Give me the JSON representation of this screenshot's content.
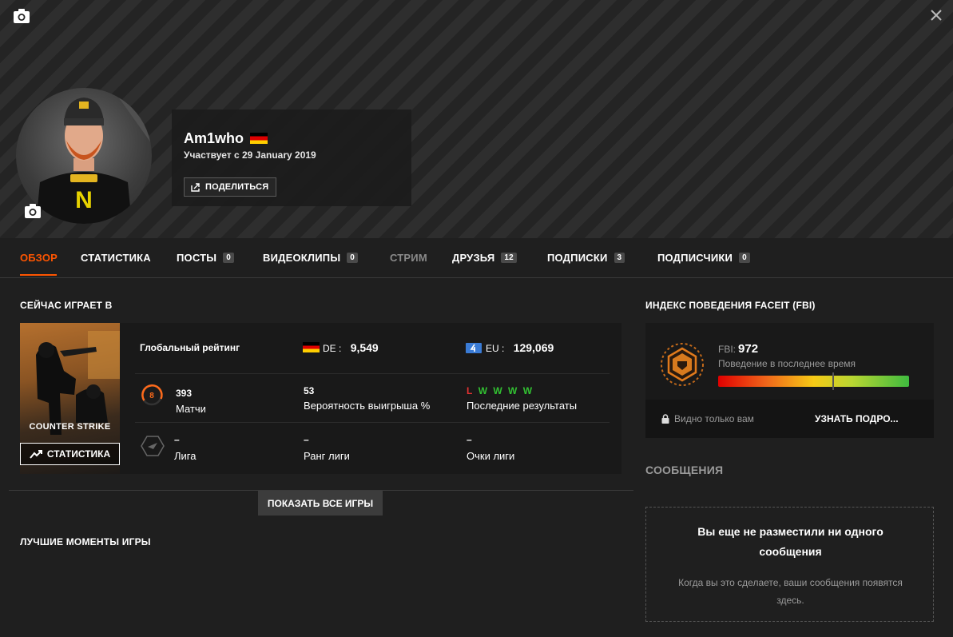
{
  "header": {
    "nickname": "Am1who",
    "joined": "Участвует с 29 January 2019",
    "share_label": "ПОДЕЛИТЬСЯ"
  },
  "tabs": [
    {
      "label": "ОБЗОР",
      "count": null
    },
    {
      "label": "СТАТИСТИКА",
      "count": null
    },
    {
      "label": "ПОСТЫ",
      "count": "0"
    },
    {
      "label": "ВИДЕОКЛИПЫ",
      "count": "0"
    },
    {
      "label": "СТРИМ",
      "count": null
    },
    {
      "label": "ДРУЗЬЯ",
      "count": "12"
    },
    {
      "label": "ПОДПИСКИ",
      "count": "3"
    },
    {
      "label": "ПОДПИСЧИКИ",
      "count": "0"
    }
  ],
  "now_playing": {
    "title": "СЕЙЧАС ИГРАЕТ В",
    "game_logo": "COUNTER STRIKE",
    "stats_button": "СТАТИСТИКА",
    "global_rating_label": "Глобальный рейтинг",
    "country_label": "DE :",
    "country_rank": "9,549",
    "region_label": "EU :",
    "region_rank": "129,069",
    "skill_level": "8",
    "matches_value": "393",
    "matches_label": "Матчи",
    "winrate_value": "53",
    "winrate_label": "Вероятность выигрыша %",
    "recent_results": [
      "L",
      "W",
      "W",
      "W",
      "W"
    ],
    "recent_label": "Последние результаты",
    "league_value": "–",
    "league_label": "Лига",
    "league_rank_value": "–",
    "league_rank_label": "Ранг лиги",
    "league_points_value": "–",
    "league_points_label": "Очки лиги",
    "show_all_label": "ПОКАЗАТЬ ВСЕ ИГРЫ"
  },
  "highlights": {
    "title": "ЛУЧШИЕ МОМЕНТЫ ИГРЫ"
  },
  "fbi": {
    "title": "ИНДЕКС ПОВЕДЕНИЯ FACEIT (FBI)",
    "score_label": "FBI:",
    "score": "972",
    "subtitle": "Поведение в последнее время",
    "level_fraction": 0.6,
    "visible_label": "Видно только вам",
    "more_label": "УЗНАТЬ ПОДРО..."
  },
  "messages": {
    "title": "СООБЩЕНИЯ",
    "empty_heading": "Вы еще не разместили ни одного сообщения",
    "empty_body": "Когда вы это сделаете, ваши сообщения появятся здесь."
  },
  "colors": {
    "accent": "#ff5500",
    "win": "#32c132",
    "loss": "#e03131"
  }
}
